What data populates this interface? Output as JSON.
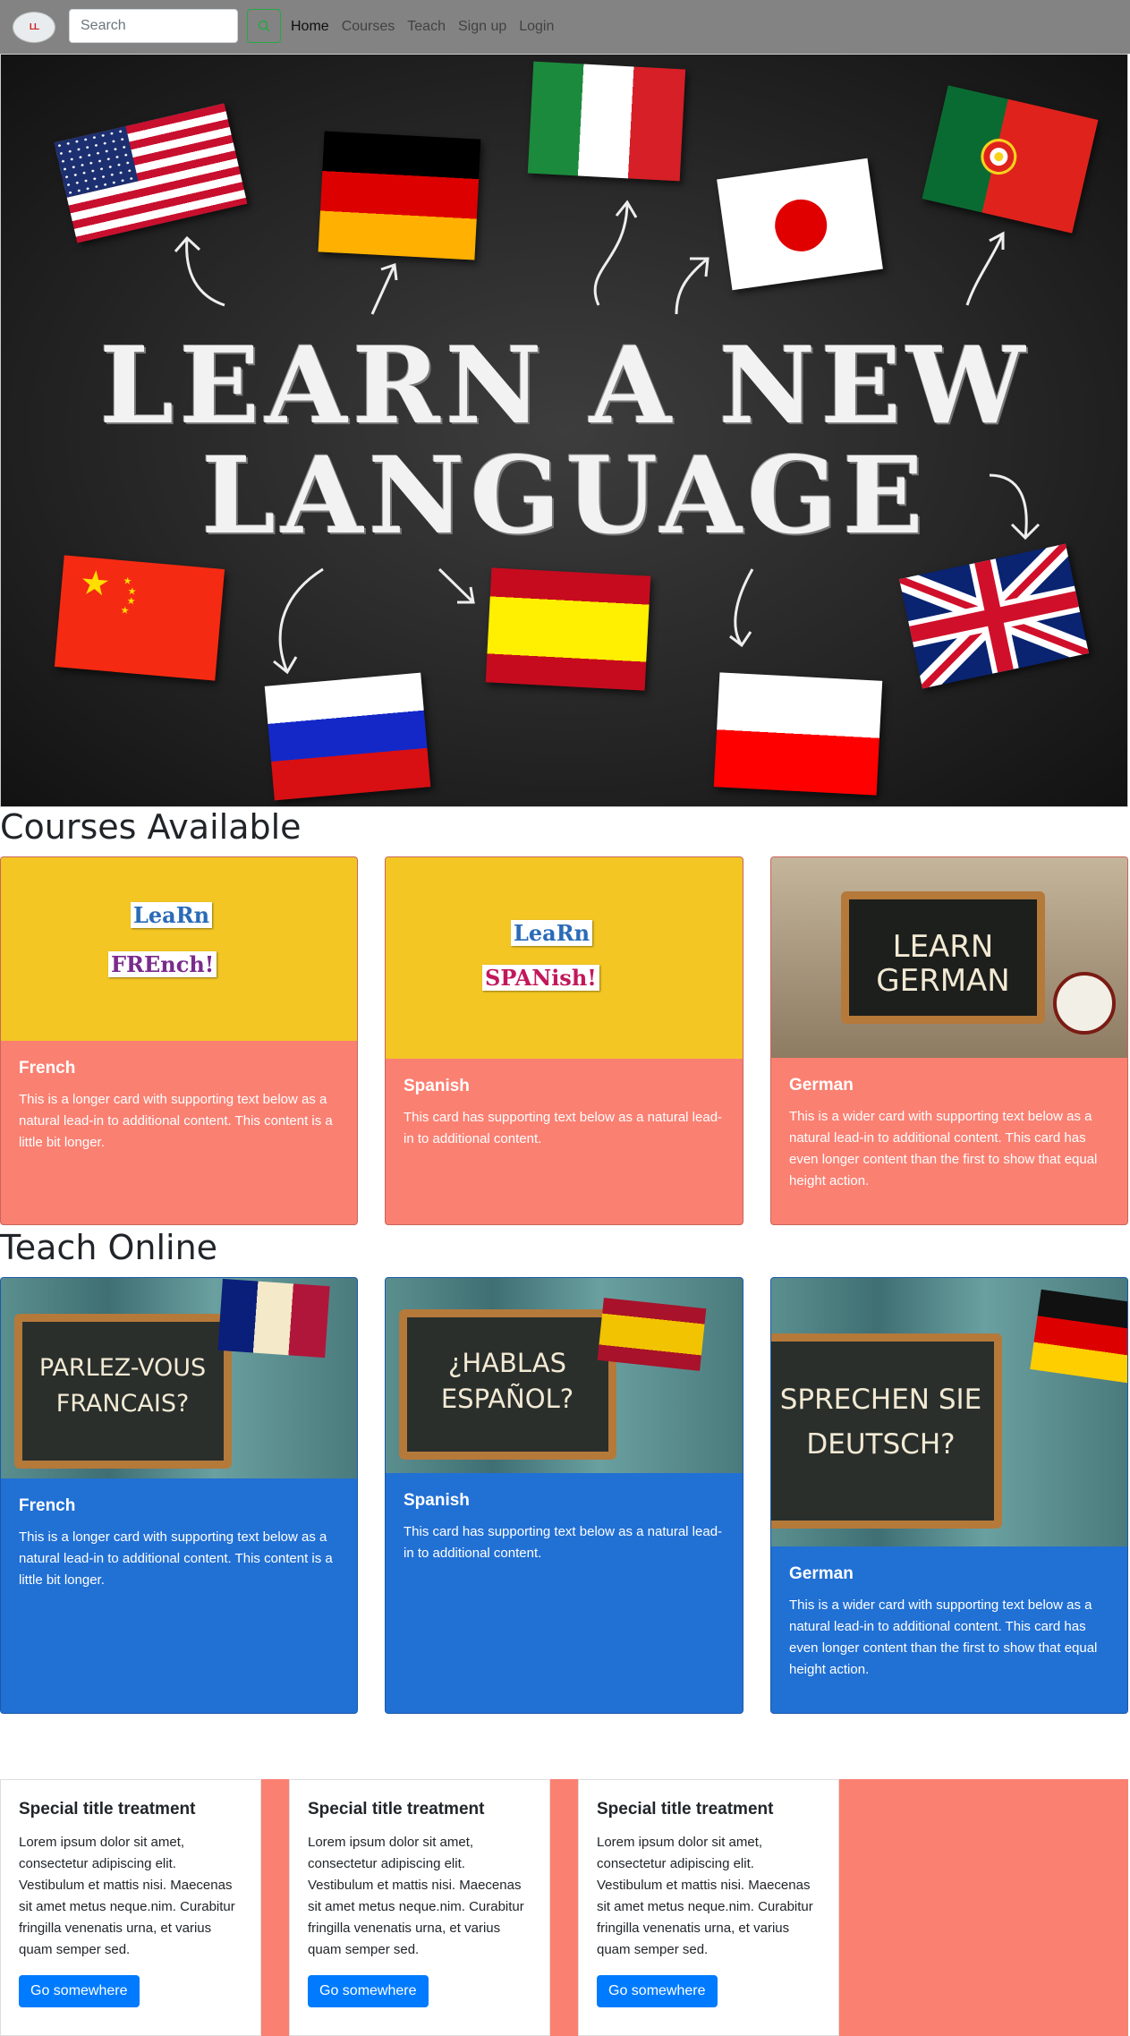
{
  "navbar": {
    "logo_text": "LL",
    "search_placeholder": "Search",
    "links": [
      "Home",
      "Courses",
      "Teach",
      "Sign up",
      "Login"
    ]
  },
  "hero": {
    "line1": "LEARN A NEW",
    "line2": "LANGUAGE"
  },
  "courses": {
    "title": "Courses Available",
    "cards": [
      {
        "title": "French",
        "text": "This is a longer card with supporting text below as a natural lead-in to additional content. This content is a little bit longer.",
        "image_text": [
          "LeaRn",
          "FREnch!"
        ]
      },
      {
        "title": "Spanish",
        "text": "This card has supporting text below as a natural lead-in to additional content.",
        "image_text": [
          "LeaRn",
          "SPANish!"
        ]
      },
      {
        "title": "German",
        "text": "This is a wider card with supporting text below as a natural lead-in to additional content. This card has even longer content than the first to show that equal height action.",
        "image_text": [
          "LEARN",
          "GERMAN"
        ]
      }
    ]
  },
  "teach": {
    "title": "Teach Online",
    "cards": [
      {
        "title": "French",
        "text": "This is a longer card with supporting text below as a natural lead-in to additional content. This content is a little bit longer.",
        "image_text": [
          "PARLEZ-VOUS",
          "FRANCAIS?"
        ]
      },
      {
        "title": "Spanish",
        "text": "This card has supporting text below as a natural lead-in to additional content.",
        "image_text": [
          "¿HABLAS",
          "ESPAÑOL?"
        ]
      },
      {
        "title": "German",
        "text": "This is a wider card with supporting text below as a natural lead-in to additional content. This card has even longer content than the first to show that equal height action.",
        "image_text": [
          "SPRECHEN SIE",
          "DEUTSCH?"
        ]
      }
    ]
  },
  "special": {
    "cards": [
      {
        "title": "Special title treatment",
        "text": "Lorem ipsum dolor sit amet, consectetur adipiscing elit. Vestibulum et mattis nisi. Maecenas sit amet metus neque.nim. Curabitur fringilla venenatis urna, et varius quam semper sed.",
        "button": "Go somewhere"
      },
      {
        "title": "Special title treatment",
        "text": "Lorem ipsum dolor sit amet, consectetur adipiscing elit. Vestibulum et mattis nisi. Maecenas sit amet metus neque.nim. Curabitur fringilla venenatis urna, et varius quam semper sed.",
        "button": "Go somewhere"
      },
      {
        "title": "Special title treatment",
        "text": "Lorem ipsum dolor sit amet, consectetur adipiscing elit. Vestibulum et mattis nisi. Maecenas sit amet metus neque.nim. Curabitur fringilla venenatis urna, et varius quam semper sed.",
        "button": "Go somewhere"
      }
    ]
  },
  "colors": {
    "navbar_bg": "#838383",
    "salmon": "#fa8072",
    "card_blue": "#2170d4",
    "button_blue": "#007bff"
  }
}
